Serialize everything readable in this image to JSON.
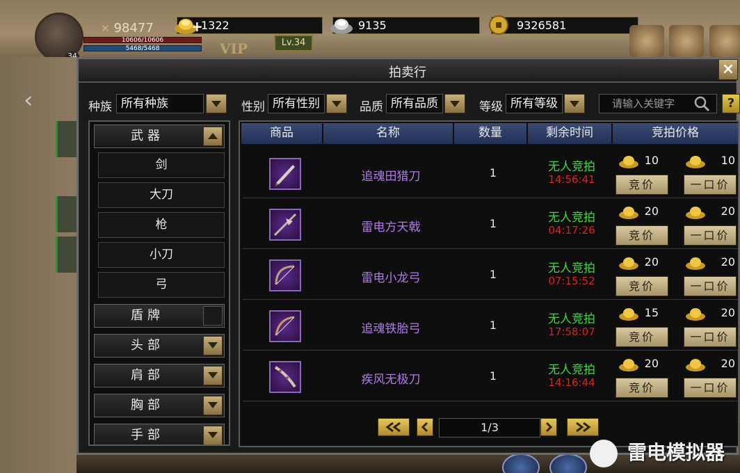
{
  "hud": {
    "combat_power": "98477",
    "hp_text": "10606/10606",
    "mp_text": "5468/5468",
    "avatar_level": "34",
    "vip_label": "VIP",
    "level_label": "Lv.34",
    "gold": "1322",
    "silver": "9135",
    "coin": "9326581"
  },
  "window": {
    "title": "拍卖行",
    "close_label": "×"
  },
  "filters": {
    "race_label": "种族",
    "race_value": "所有种族",
    "gender_label": "性别",
    "gender_value": "所有性别",
    "quality_label": "品质",
    "quality_value": "所有品质",
    "level_label": "等级",
    "level_value": "所有等级",
    "search_placeholder": "请输入关键字",
    "help_label": "?"
  },
  "categories": {
    "weapon": "武器",
    "weapon_subs": [
      "剑",
      "大刀",
      "枪",
      "小刀",
      "弓"
    ],
    "shield": "盾牌",
    "head": "头部",
    "shoulder": "肩部",
    "chest": "胸部",
    "hand": "手部"
  },
  "table": {
    "headers": [
      "商品",
      "名称",
      "数量",
      "剩余时间",
      "竞拍价格"
    ],
    "rows": [
      {
        "name": "追魂田猎刀",
        "qty": "1",
        "status": "无人竞拍",
        "time": "14:56:41",
        "bid_price": "10",
        "buyout_price": "10"
      },
      {
        "name": "雷电方天戟",
        "qty": "1",
        "status": "无人竞拍",
        "time": "04:17:26",
        "bid_price": "20",
        "buyout_price": "20"
      },
      {
        "name": "雷电小龙弓",
        "qty": "1",
        "status": "无人竞拍",
        "time": "07:15:52",
        "bid_price": "20",
        "buyout_price": "20"
      },
      {
        "name": "追魂铁胎弓",
        "qty": "1",
        "status": "无人竞拍",
        "time": "17:58:07",
        "bid_price": "15",
        "buyout_price": "20"
      },
      {
        "name": "疾风无极刀",
        "qty": "1",
        "status": "无人竞拍",
        "time": "14:16:44",
        "bid_price": "20",
        "buyout_price": "20"
      }
    ],
    "bid_button": "竞价",
    "buyout_button": "一口价"
  },
  "pager": {
    "page": "1/3"
  },
  "watermark": "雷电模拟器",
  "colors": {
    "status_green": "#3ad83a",
    "timer_red": "#e02020",
    "item_purple": "#b07ae8",
    "header_blue": "#2a3a64",
    "button_gold": "#c8b078"
  }
}
